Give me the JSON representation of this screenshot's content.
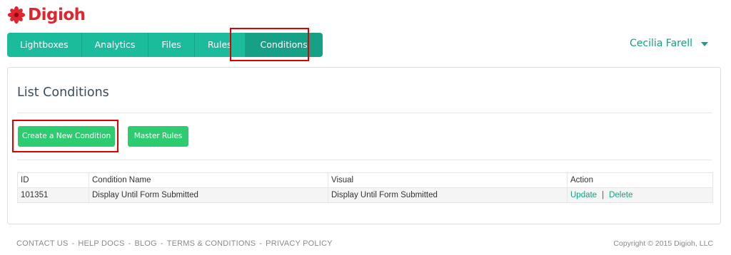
{
  "brand": {
    "name": "Digioh",
    "color": "#e0252e"
  },
  "nav": {
    "items": [
      {
        "label": "Lightboxes"
      },
      {
        "label": "Analytics"
      },
      {
        "label": "Files"
      },
      {
        "label": "Rules"
      },
      {
        "label": "Conditions",
        "active": true
      }
    ]
  },
  "user": {
    "name": "Cecilia Farell"
  },
  "page": {
    "title": "List Conditions",
    "buttons": {
      "create": "Create a New Condition",
      "master": "Master Rules"
    }
  },
  "table": {
    "headers": [
      "ID",
      "Condition Name",
      "Visual",
      "Action"
    ],
    "rows": [
      {
        "id": "101351",
        "name": "Display Until Form Submitted",
        "visual": "Display Until Form Submitted",
        "actions": [
          "Update",
          "Delete"
        ]
      }
    ]
  },
  "footer": {
    "links": [
      "CONTACT US",
      "HELP DOCS",
      "BLOG",
      "TERMS & CONDITIONS",
      "PRIVACY POLICY"
    ],
    "copyright": "Copyright © 2015 Digioh, LLC"
  },
  "colors": {
    "accent": "#1abc9c",
    "accent_dark": "#16a085",
    "button": "#2ecc71",
    "highlight": "#e00000"
  }
}
